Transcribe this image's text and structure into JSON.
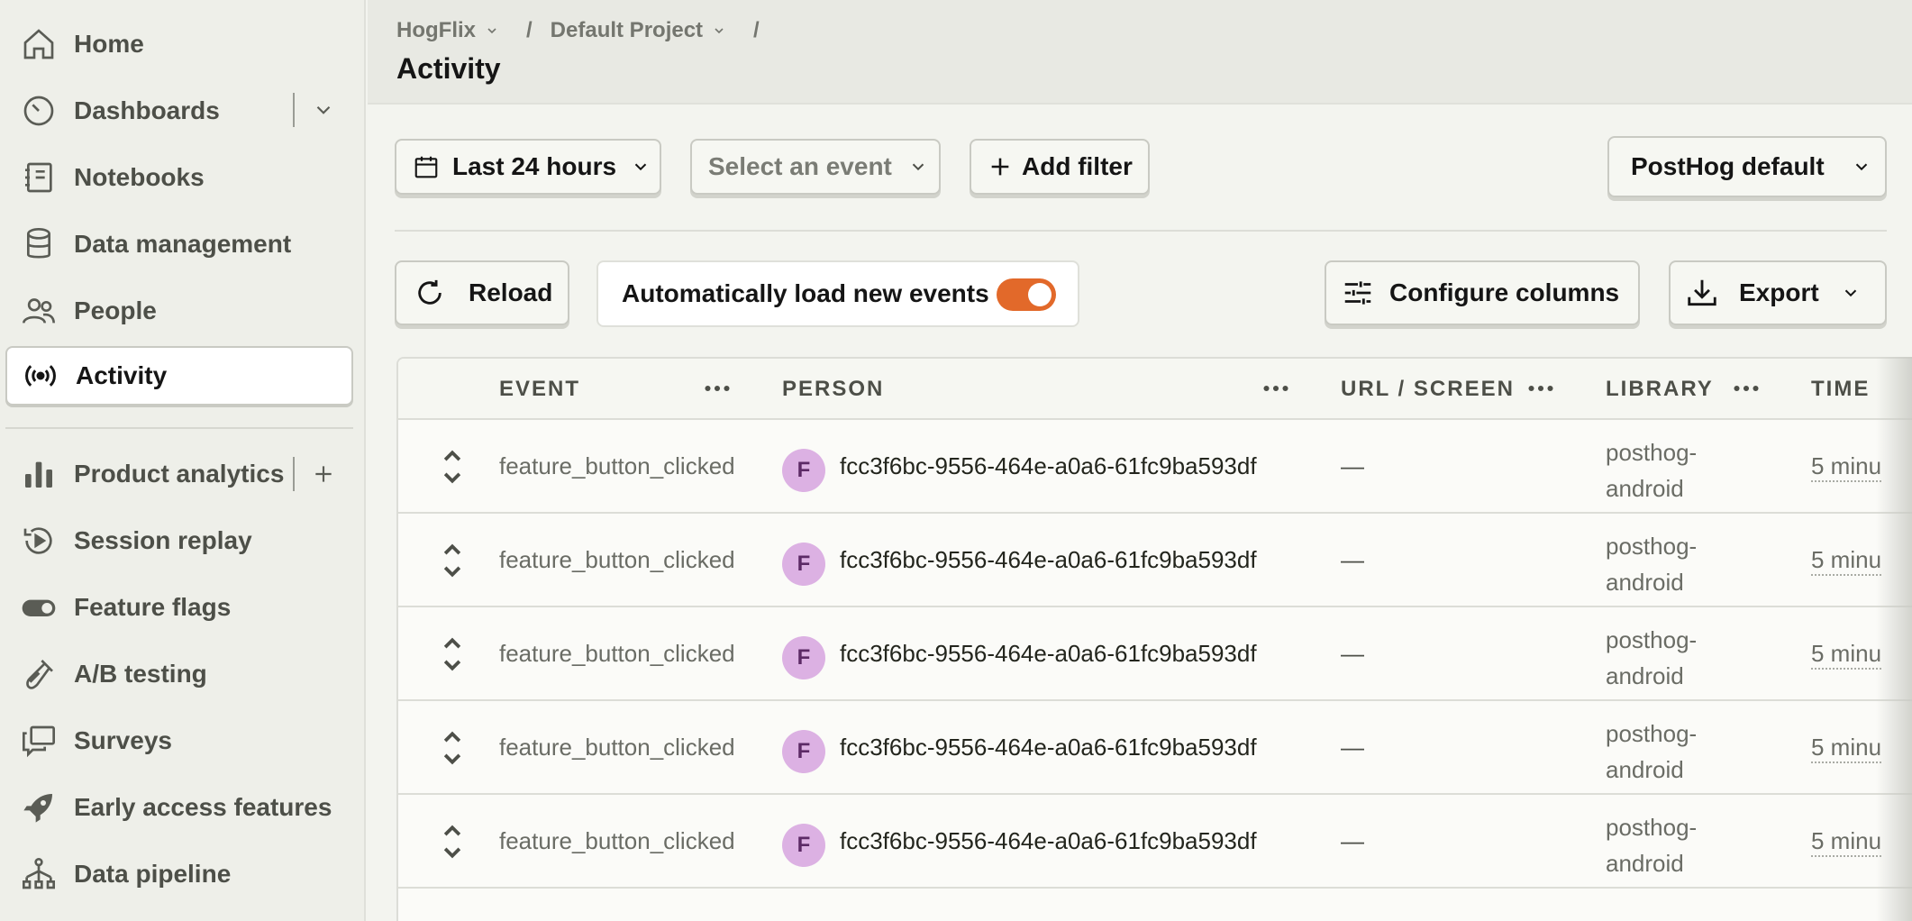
{
  "sidebar": {
    "items": [
      {
        "label": "Home",
        "icon": "home-icon"
      },
      {
        "label": "Dashboards",
        "icon": "gauge-icon"
      },
      {
        "label": "Notebooks",
        "icon": "notebook-icon"
      },
      {
        "label": "Data management",
        "icon": "database-icon"
      },
      {
        "label": "People",
        "icon": "people-icon"
      },
      {
        "label": "Activity",
        "icon": "broadcast-icon",
        "active": true
      },
      {
        "label": "Product analytics",
        "icon": "bar-chart-icon"
      },
      {
        "label": "Session replay",
        "icon": "replay-icon"
      },
      {
        "label": "Feature flags",
        "icon": "toggle-icon"
      },
      {
        "label": "A/B testing",
        "icon": "flask-icon"
      },
      {
        "label": "Surveys",
        "icon": "chat-icon"
      },
      {
        "label": "Early access features",
        "icon": "rocket-icon"
      },
      {
        "label": "Data pipeline",
        "icon": "pipeline-icon"
      }
    ]
  },
  "header": {
    "breadcrumb": [
      "HogFlix",
      "Default Project"
    ],
    "separator": "/",
    "title": "Activity"
  },
  "filters": {
    "date_range": "Last 24 hours",
    "event_placeholder": "Select an event",
    "add_filter": "Add filter",
    "columns_preset": "PostHog default"
  },
  "toolbar": {
    "reload": "Reload",
    "auto_load_label": "Automatically load new events",
    "auto_load_on": true,
    "configure_columns": "Configure columns",
    "export": "Export"
  },
  "table": {
    "columns": [
      "EVENT",
      "PERSON",
      "URL / SCREEN",
      "LIBRARY",
      "TIME"
    ],
    "rows": [
      {
        "event": "feature_button_clicked",
        "avatar": "F",
        "person": "fcc3f6bc-9556-464e-a0a6-61fc9ba593df",
        "url": "—",
        "library": "posthog-android",
        "time": "5 minu"
      },
      {
        "event": "feature_button_clicked",
        "avatar": "F",
        "person": "fcc3f6bc-9556-464e-a0a6-61fc9ba593df",
        "url": "—",
        "library": "posthog-android",
        "time": "5 minu"
      },
      {
        "event": "feature_button_clicked",
        "avatar": "F",
        "person": "fcc3f6bc-9556-464e-a0a6-61fc9ba593df",
        "url": "—",
        "library": "posthog-android",
        "time": "5 minu"
      },
      {
        "event": "feature_button_clicked",
        "avatar": "F",
        "person": "fcc3f6bc-9556-464e-a0a6-61fc9ba593df",
        "url": "—",
        "library": "posthog-android",
        "time": "5 minu"
      },
      {
        "event": "feature_button_clicked",
        "avatar": "F",
        "person": "fcc3f6bc-9556-464e-a0a6-61fc9ba593df",
        "url": "—",
        "library": "posthog-android",
        "time": "5 minu"
      }
    ]
  },
  "colors": {
    "accent": "#e2692a",
    "avatar_bg": "#dcb1e3",
    "sidebar_bg": "#eeefe9"
  }
}
